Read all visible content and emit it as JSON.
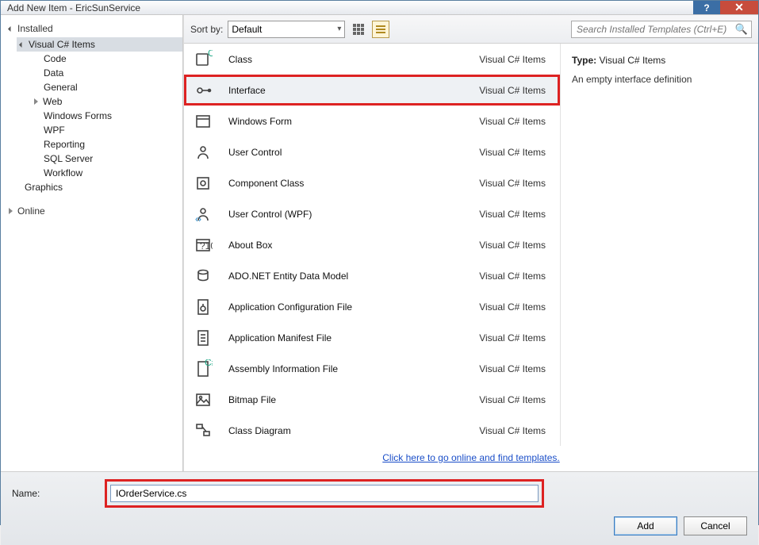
{
  "title": "Add New Item - EricSunService",
  "sidebar": {
    "installed_label": "Installed",
    "online_label": "Online",
    "root_label": "Visual C# Items",
    "items": [
      {
        "label": "Code"
      },
      {
        "label": "Data"
      },
      {
        "label": "General"
      },
      {
        "label": "Web",
        "has_children": true
      },
      {
        "label": "Windows Forms"
      },
      {
        "label": "WPF"
      },
      {
        "label": "Reporting"
      },
      {
        "label": "SQL Server"
      },
      {
        "label": "Workflow"
      }
    ],
    "graphics_label": "Graphics"
  },
  "toolbar": {
    "sortby_label": "Sort by:",
    "sort_value": "Default",
    "search_placeholder": "Search Installed Templates (Ctrl+E)"
  },
  "templates": [
    {
      "name": "Class",
      "category": "Visual C# Items",
      "icon": "class"
    },
    {
      "name": "Interface",
      "category": "Visual C# Items",
      "icon": "interface",
      "selected": true
    },
    {
      "name": "Windows Form",
      "category": "Visual C# Items",
      "icon": "form"
    },
    {
      "name": "User Control",
      "category": "Visual C# Items",
      "icon": "usercontrol"
    },
    {
      "name": "Component Class",
      "category": "Visual C# Items",
      "icon": "component"
    },
    {
      "name": "User Control (WPF)",
      "category": "Visual C# Items",
      "icon": "usercontrol-wpf"
    },
    {
      "name": "About Box",
      "category": "Visual C# Items",
      "icon": "about"
    },
    {
      "name": "ADO.NET Entity Data Model",
      "category": "Visual C# Items",
      "icon": "ado"
    },
    {
      "name": "Application Configuration File",
      "category": "Visual C# Items",
      "icon": "config"
    },
    {
      "name": "Application Manifest File",
      "category": "Visual C# Items",
      "icon": "manifest"
    },
    {
      "name": "Assembly Information File",
      "category": "Visual C# Items",
      "icon": "assembly"
    },
    {
      "name": "Bitmap File",
      "category": "Visual C# Items",
      "icon": "bitmap"
    },
    {
      "name": "Class Diagram",
      "category": "Visual C# Items",
      "icon": "diagram"
    }
  ],
  "online_link": "Click here to go online and find templates.",
  "detail": {
    "type_label": "Type:",
    "type_value": "Visual C# Items",
    "description": "An empty interface definition"
  },
  "name_label": "Name:",
  "name_value": "IOrderService.cs",
  "buttons": {
    "add": "Add",
    "cancel": "Cancel"
  }
}
